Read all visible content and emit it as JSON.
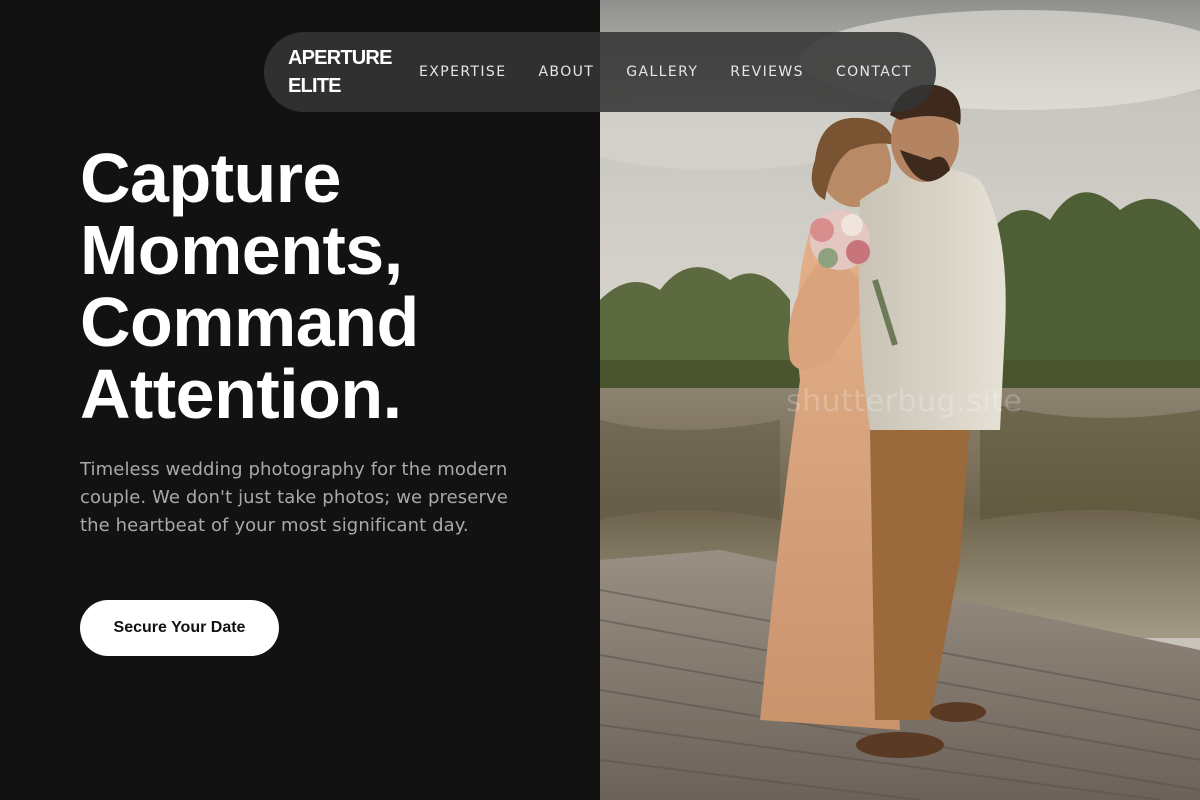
{
  "nav": {
    "brand_line1": "APERTURE",
    "brand_line2": "ELITE",
    "links": [
      "EXPERTISE",
      "ABOUT",
      "GALLERY",
      "REVIEWS",
      "CONTACT"
    ]
  },
  "hero": {
    "title_lines": [
      "Capture",
      "Moments,",
      "Command",
      "Attention."
    ],
    "subtitle": "Timeless wedding photography for the modern couple. We don't just take photos; we preserve the heartbeat of your most significant day.",
    "cta_label": "Secure Your Date"
  },
  "photo": {
    "watermark": "shutterbug.site",
    "subject": "wedding couple embracing on a wooden dock by a lake"
  },
  "colors": {
    "background": "#121212",
    "nav_pill": "#343434",
    "text_primary": "#ffffff",
    "text_secondary": "#a9a9ad",
    "cta_background": "#ffffff",
    "cta_text": "#111111"
  }
}
